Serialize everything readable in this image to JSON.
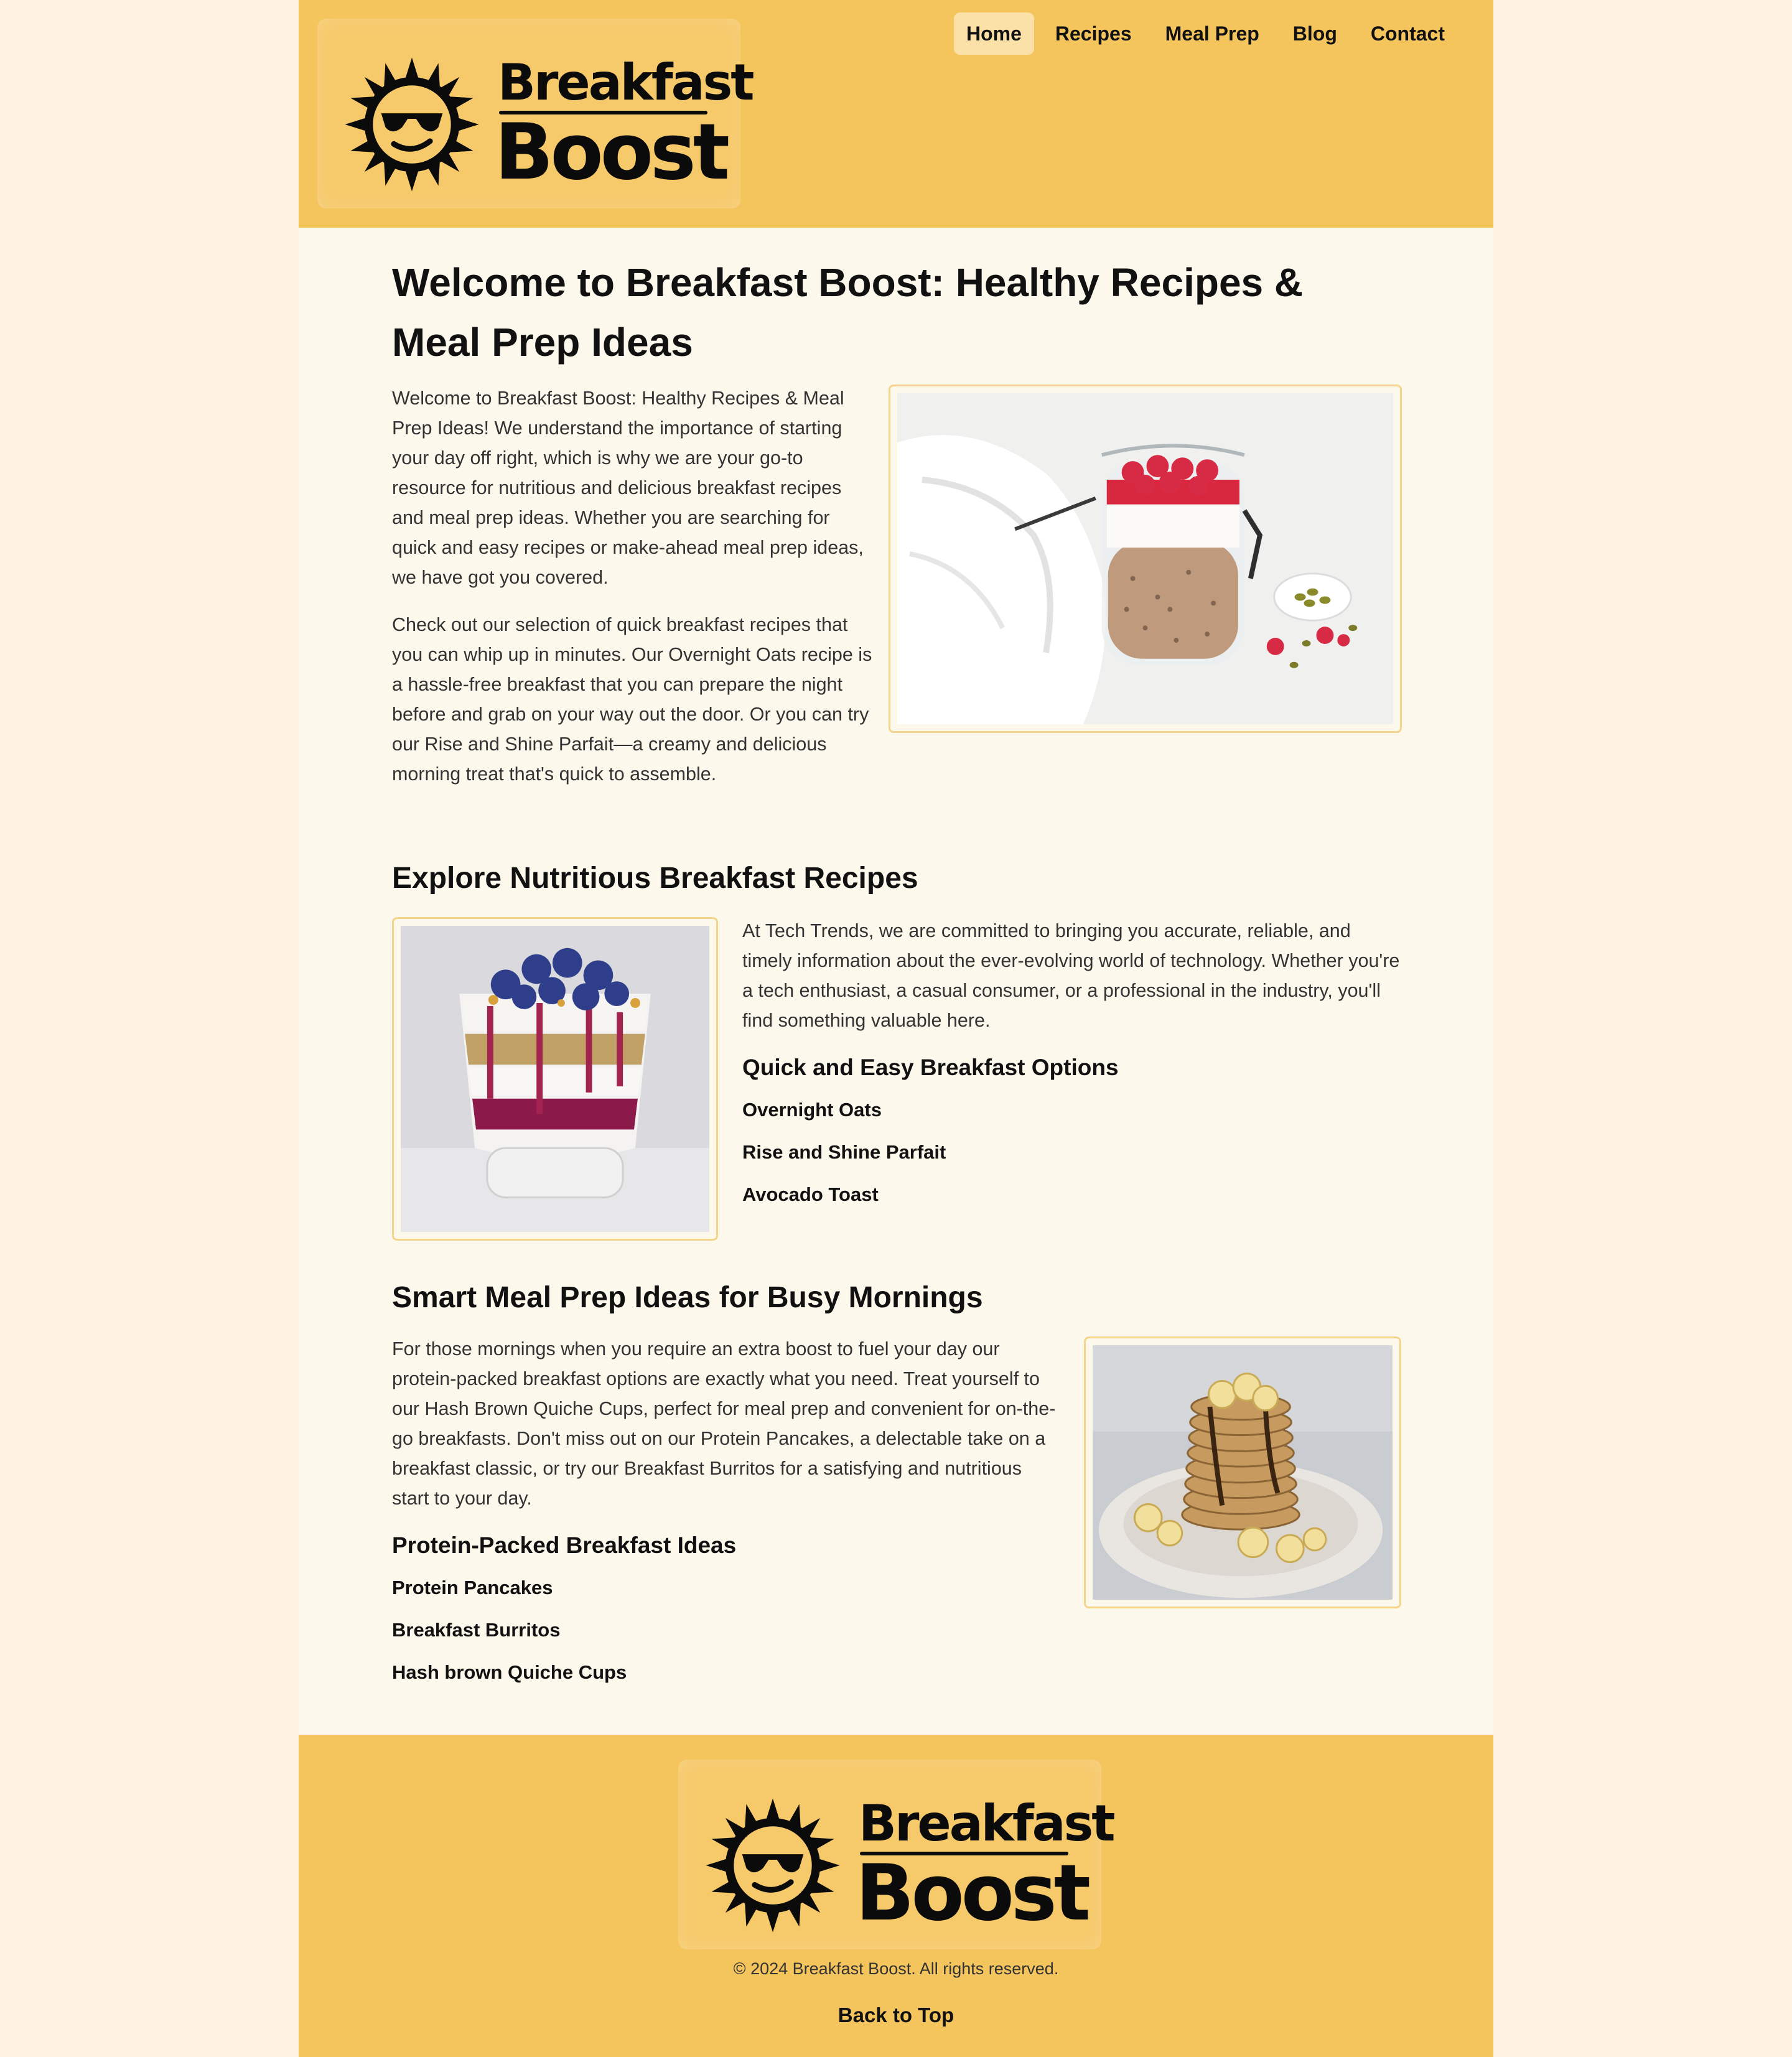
{
  "nav": {
    "items": [
      {
        "label": "Home",
        "active": true
      },
      {
        "label": "Recipes",
        "active": false
      },
      {
        "label": "Meal Prep",
        "active": false
      },
      {
        "label": "Blog",
        "active": false
      },
      {
        "label": "Contact",
        "active": false
      }
    ]
  },
  "logo": {
    "word1": "Breakfast",
    "word2": "Boost",
    "icon": "sun-sunglasses-icon"
  },
  "hero": {
    "title": "Welcome to Breakfast Boost: Healthy Recipes & Meal Prep Ideas",
    "para1": "Welcome to Breakfast Boost: Healthy Recipes & Meal Prep Ideas! We understand the importance of starting your day off right, which is why we are your go-to resource for nutritious and delicious breakfast recipes and meal prep ideas. Whether you are searching for quick and easy recipes or make-ahead meal prep ideas, we have got you covered.",
    "para2": "Check out our selection of quick breakfast recipes that you can whip up in minutes. Our Overnight Oats recipe is a hassle-free breakfast that you can prepare the night before and grab on your way out the door. Or you can try our Rise and Shine Parfait—a creamy and delicious morning treat that's quick to assemble."
  },
  "recipes": {
    "heading": "Explore Nutritious Breakfast Recipes",
    "para": "At Tech Trends, we are committed to bringing you accurate, reliable, and timely information about the ever-evolving world of technology. Whether you're a tech enthusiast, a casual consumer, or a professional in the industry, you'll find something valuable here.",
    "subheading": "Quick and Easy Breakfast Options",
    "items": [
      "Overnight Oats",
      "Rise and Shine Parfait",
      "Avocado Toast"
    ]
  },
  "mealprep": {
    "heading": "Smart Meal Prep Ideas for Busy Mornings",
    "para": "For those mornings when you require an extra boost to fuel your day our protein-packed breakfast options are exactly what you need. Treat yourself to our Hash Brown Quiche Cups, perfect for meal prep and convenient for on-the-go breakfasts. Don't miss out on our Protein Pancakes, a delectable take on a breakfast classic, or try our Breakfast Burritos for a satisfying and nutritious start to your day.",
    "subheading": "Protein-Packed Breakfast Ideas",
    "items": [
      "Protein Pancakes",
      "Breakfast Burritos",
      "Hash brown Quiche Cups"
    ]
  },
  "footer": {
    "copyright": "© 2024 Breakfast Boost. All rights reserved.",
    "back_to_top": "Back to Top"
  },
  "colors": {
    "brand": "#f4c45d",
    "background": "#fdf8ec",
    "nav_active": "#fbe1a7",
    "frame": "#f5d58b"
  }
}
